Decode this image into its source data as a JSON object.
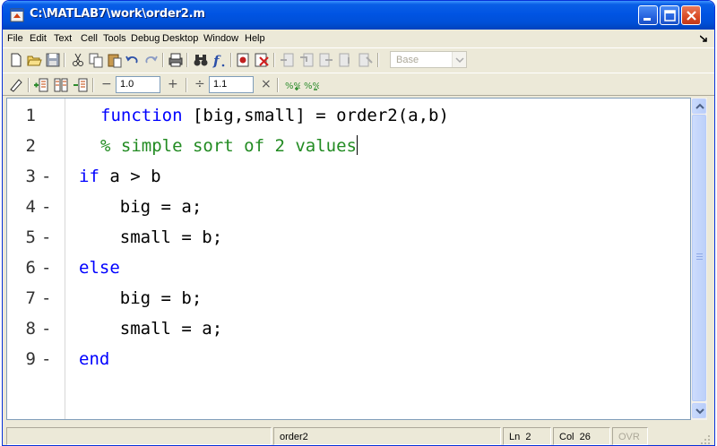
{
  "window": {
    "title": "C:\\MATLAB7\\work\\order2.m"
  },
  "menubar": {
    "items": [
      {
        "label": "File"
      },
      {
        "label": "Edit"
      },
      {
        "label": "Text"
      },
      {
        "label": "Cell"
      },
      {
        "label": "Tools"
      },
      {
        "label": "Debug"
      },
      {
        "label": "Desktop"
      },
      {
        "label": "Window"
      },
      {
        "label": "Help"
      }
    ]
  },
  "toolbar": {
    "stack_label": "Base",
    "cell_left_value": "1.0",
    "cell_right_value": "1.1",
    "op_minus": "−",
    "op_plus": "+",
    "op_divide": "÷",
    "op_times": "×"
  },
  "editor": {
    "lines": [
      {
        "num": "1",
        "bp": "",
        "code": "    function [big,small] = order2(a,b)"
      },
      {
        "num": "2",
        "bp": "",
        "code": "    % simple sort of 2 values"
      },
      {
        "num": "3",
        "bp": "-",
        "code": "if a > b"
      },
      {
        "num": "4",
        "bp": "-",
        "code": "    big = a;"
      },
      {
        "num": "5",
        "bp": "-",
        "code": "    small = b;"
      },
      {
        "num": "6",
        "bp": "-",
        "code": "else"
      },
      {
        "num": "7",
        "bp": "-",
        "code": "    big = b;"
      },
      {
        "num": "8",
        "bp": "-",
        "code": "    small = a;"
      },
      {
        "num": "9",
        "bp": "-",
        "code": "end"
      }
    ],
    "l1_kw": "function",
    "l1_rest": " [big,small] = order2(a,b)",
    "l2_comment": "% simple sort of 2 values",
    "l3_kw": "if",
    "l3_rest": " a > b",
    "l4": "    big = a;",
    "l5": "    small = b;",
    "l6_kw": "else",
    "l7": "    big = b;",
    "l8": "    small = a;",
    "l9_kw": "end"
  },
  "statusbar": {
    "function_name": "order2",
    "ln_label": "Ln",
    "ln_value": "2",
    "col_label": "Col",
    "col_value": "26",
    "ovr": "OVR"
  },
  "colors": {
    "keyword": "#0000ff",
    "comment": "#228b22",
    "titlebar": "#0054e3"
  }
}
